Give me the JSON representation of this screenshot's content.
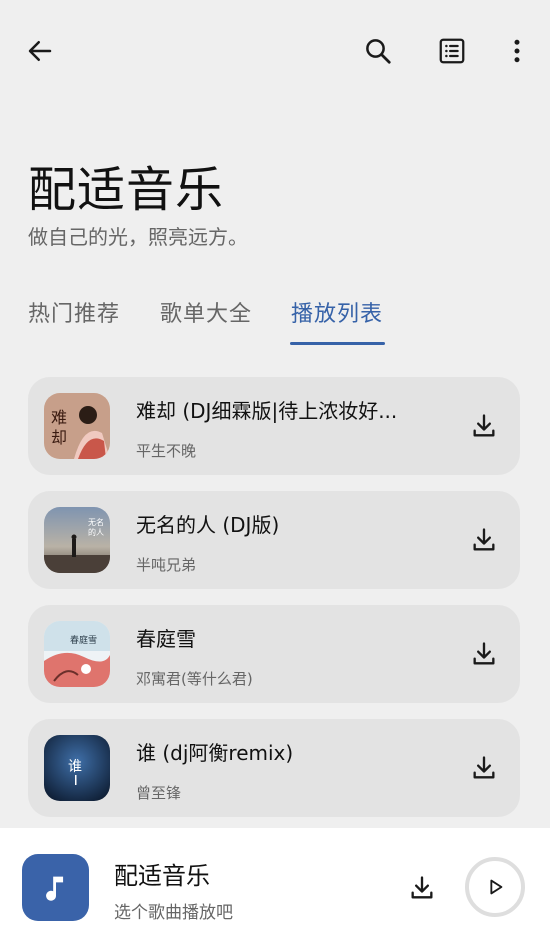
{
  "toolbar": {
    "back_icon": "arrow-left-icon",
    "search_icon": "search-icon",
    "list_icon": "list-view-icon",
    "more_icon": "more-vertical-icon"
  },
  "header": {
    "title": "配适音乐",
    "subtitle": "做自己的光，照亮远方。"
  },
  "tabs": [
    {
      "label": "热门推荐",
      "active": false
    },
    {
      "label": "歌单大全",
      "active": false
    },
    {
      "label": "播放列表",
      "active": true
    }
  ],
  "songs": [
    {
      "title": "难却 (DJ细霖版|待上浓妆好...",
      "artist": "平生不晚",
      "cover_text": "难却"
    },
    {
      "title": "无名的人 (DJ版)",
      "artist": "半吨兄弟",
      "cover_text": "无名的人"
    },
    {
      "title": "春庭雪",
      "artist": "邓寓君(等什么君)",
      "cover_text": "春庭雪"
    },
    {
      "title": "谁 (dj阿衡remix)",
      "artist": "曾至锋",
      "cover_text": "谁"
    }
  ],
  "player": {
    "title": "配适音乐",
    "subtitle": "选个歌曲播放吧",
    "art_icon": "music-note-icon",
    "download_icon": "download-icon",
    "play_icon": "play-icon"
  },
  "colors": {
    "accent": "#3662a8",
    "background": "#efefef",
    "card": "#e3e3e3"
  }
}
